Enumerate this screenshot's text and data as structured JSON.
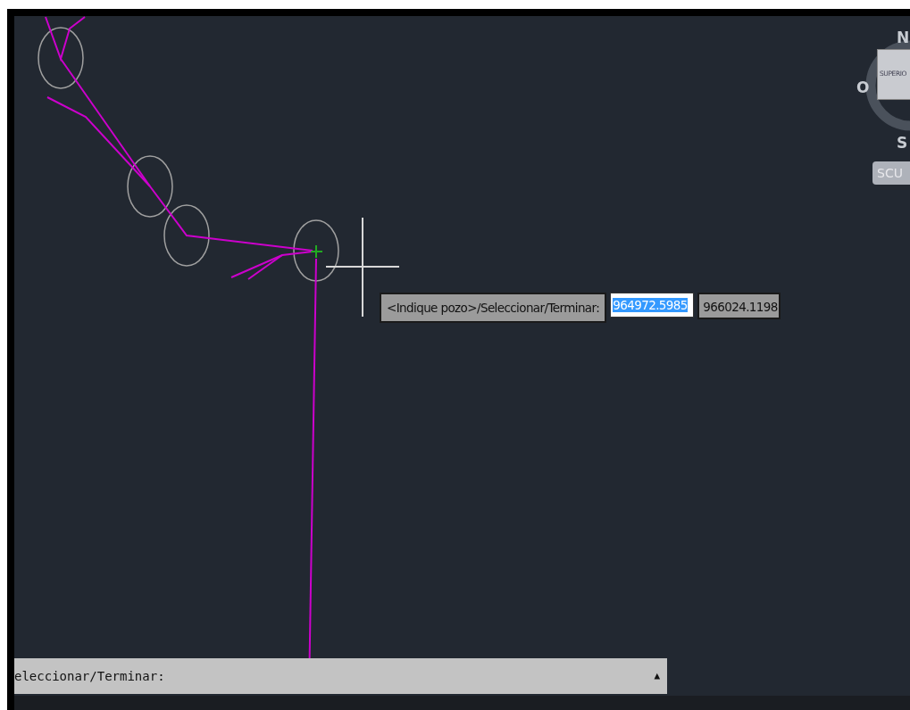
{
  "viewcube": {
    "north": "N",
    "west": "O",
    "south": "S",
    "face": "SUPERIO",
    "ucs": "SCU"
  },
  "tooltip": {
    "prompt": "<Indique pozo>/Seleccionar/Terminar:",
    "input_value": "964972.5985",
    "input_selected": true,
    "second_value": "966024.1198"
  },
  "command_line": {
    "text": "eleccionar/Terminar:",
    "arrow": "▲"
  }
}
